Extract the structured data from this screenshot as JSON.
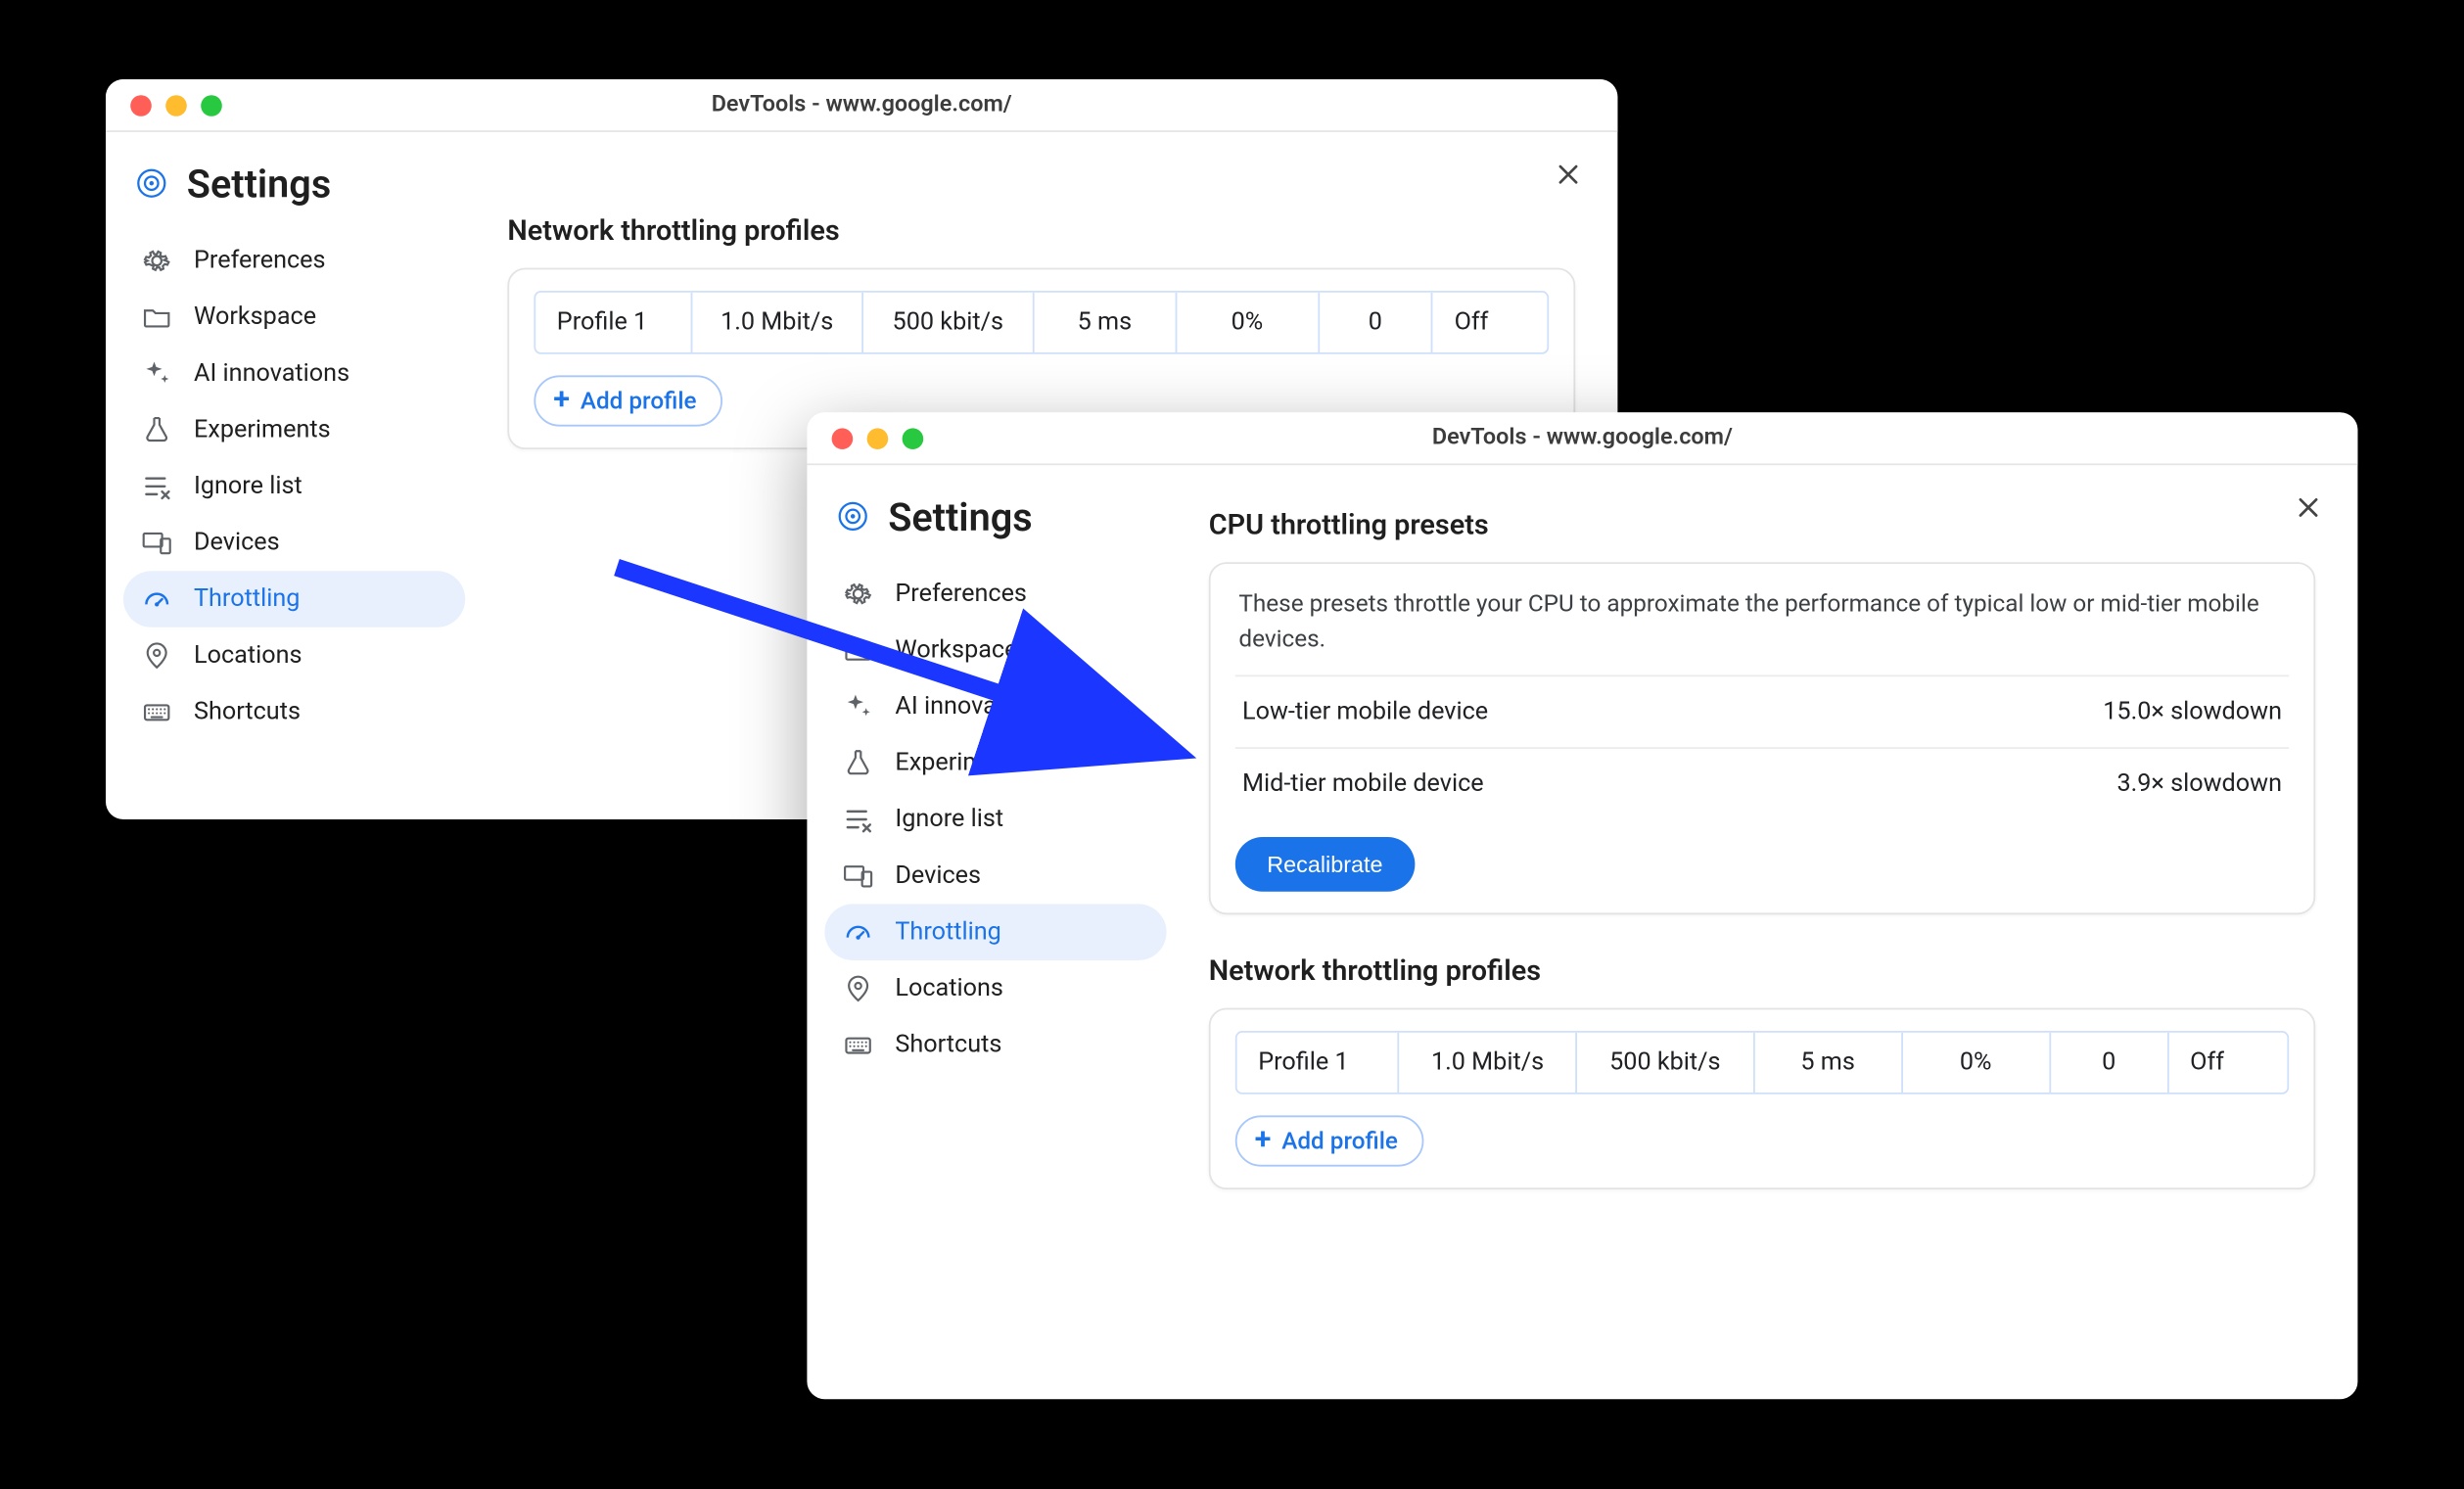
{
  "windowA": {
    "title": "DevTools - www.google.com/",
    "settings_label": "Settings",
    "nav": [
      "Preferences",
      "Workspace",
      "AI innovations",
      "Experiments",
      "Ignore list",
      "Devices",
      "Throttling",
      "Locations",
      "Shortcuts"
    ],
    "nav_selected_index": 6,
    "net_title": "Network throttling profiles",
    "profile": [
      "Profile 1",
      "1.0 Mbit/s",
      "500 kbit/s",
      "5 ms",
      "0%",
      "0",
      "Off"
    ],
    "add_profile": "Add profile"
  },
  "windowB": {
    "title": "DevTools - www.google.com/",
    "settings_label": "Settings",
    "nav": [
      "Preferences",
      "Workspace",
      "AI innovations",
      "Experiments",
      "Ignore list",
      "Devices",
      "Throttling",
      "Locations",
      "Shortcuts"
    ],
    "nav_selected_index": 6,
    "cpu_title": "CPU throttling presets",
    "cpu_desc": "These presets throttle your CPU to approximate the performance of typical low or mid-tier mobile devices.",
    "presets": [
      {
        "name": "Low-tier mobile device",
        "value": "15.0× slowdown"
      },
      {
        "name": "Mid-tier mobile device",
        "value": "3.9× slowdown"
      }
    ],
    "recalibrate": "Recalibrate",
    "net_title": "Network throttling profiles",
    "profile": [
      "Profile 1",
      "1.0 Mbit/s",
      "500 kbit/s",
      "5 ms",
      "0%",
      "0",
      "Off"
    ],
    "add_profile": "Add profile"
  },
  "icons": [
    "gear-icon",
    "folder-icon",
    "sparkle-icon",
    "flask-icon",
    "ignore-list-icon",
    "devices-icon",
    "throttling-gauge-icon",
    "location-pin-icon",
    "keyboard-icon"
  ],
  "colors": {
    "accent": "#1a73e8",
    "arrow": "#1a36ff"
  }
}
